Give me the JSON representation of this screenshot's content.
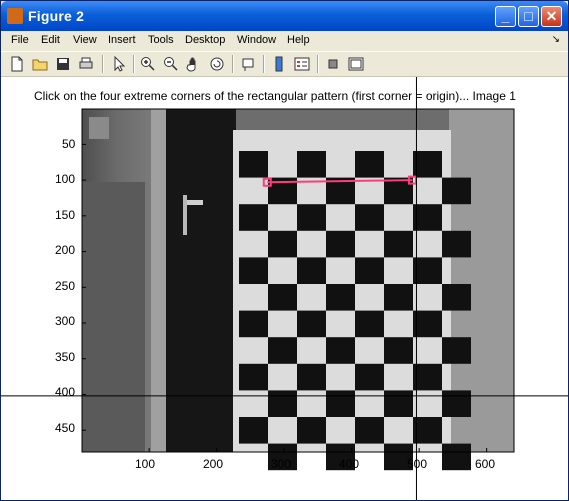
{
  "window": {
    "title": "Figure 2",
    "icon": "matlab-icon",
    "controls": [
      "minimize",
      "maximize",
      "close"
    ]
  },
  "menu": [
    "File",
    "Edit",
    "View",
    "Insert",
    "Tools",
    "Desktop",
    "Window",
    "Help"
  ],
  "menu_arrow": "↘",
  "toolbar": [
    "new-file-icon",
    "open-folder-icon",
    "save-icon",
    "print-icon",
    "pointer-icon",
    "zoom-in-icon",
    "zoom-out-icon",
    "pan-hand-icon",
    "rotate-3d-icon",
    "data-cursor-icon",
    "colorbar-icon",
    "legend-icon",
    "hide-plot-tools-icon",
    "show-plot-tools-icon"
  ],
  "plot": {
    "title": "Click on the four extreme corners of the rectangular pattern (first corner = origin)... Image 1",
    "xticks": [
      "100",
      "200",
      "300",
      "400",
      "500",
      "600"
    ],
    "yticks": [
      "50",
      "100",
      "150",
      "200",
      "250",
      "300",
      "350",
      "400",
      "450"
    ],
    "image_content": "grayscale photo of a checkerboard calibration pattern",
    "checker_grid": {
      "rows": 12,
      "cols": 8
    },
    "clicked_corners": [
      {
        "x": 275,
        "y": 103
      },
      {
        "x": 490,
        "y": 100
      }
    ],
    "crosshair": {
      "x": 496,
      "y": 402
    },
    "colors": {
      "clicked_line": "#ff3d7a",
      "crosshair": "#000000"
    }
  }
}
